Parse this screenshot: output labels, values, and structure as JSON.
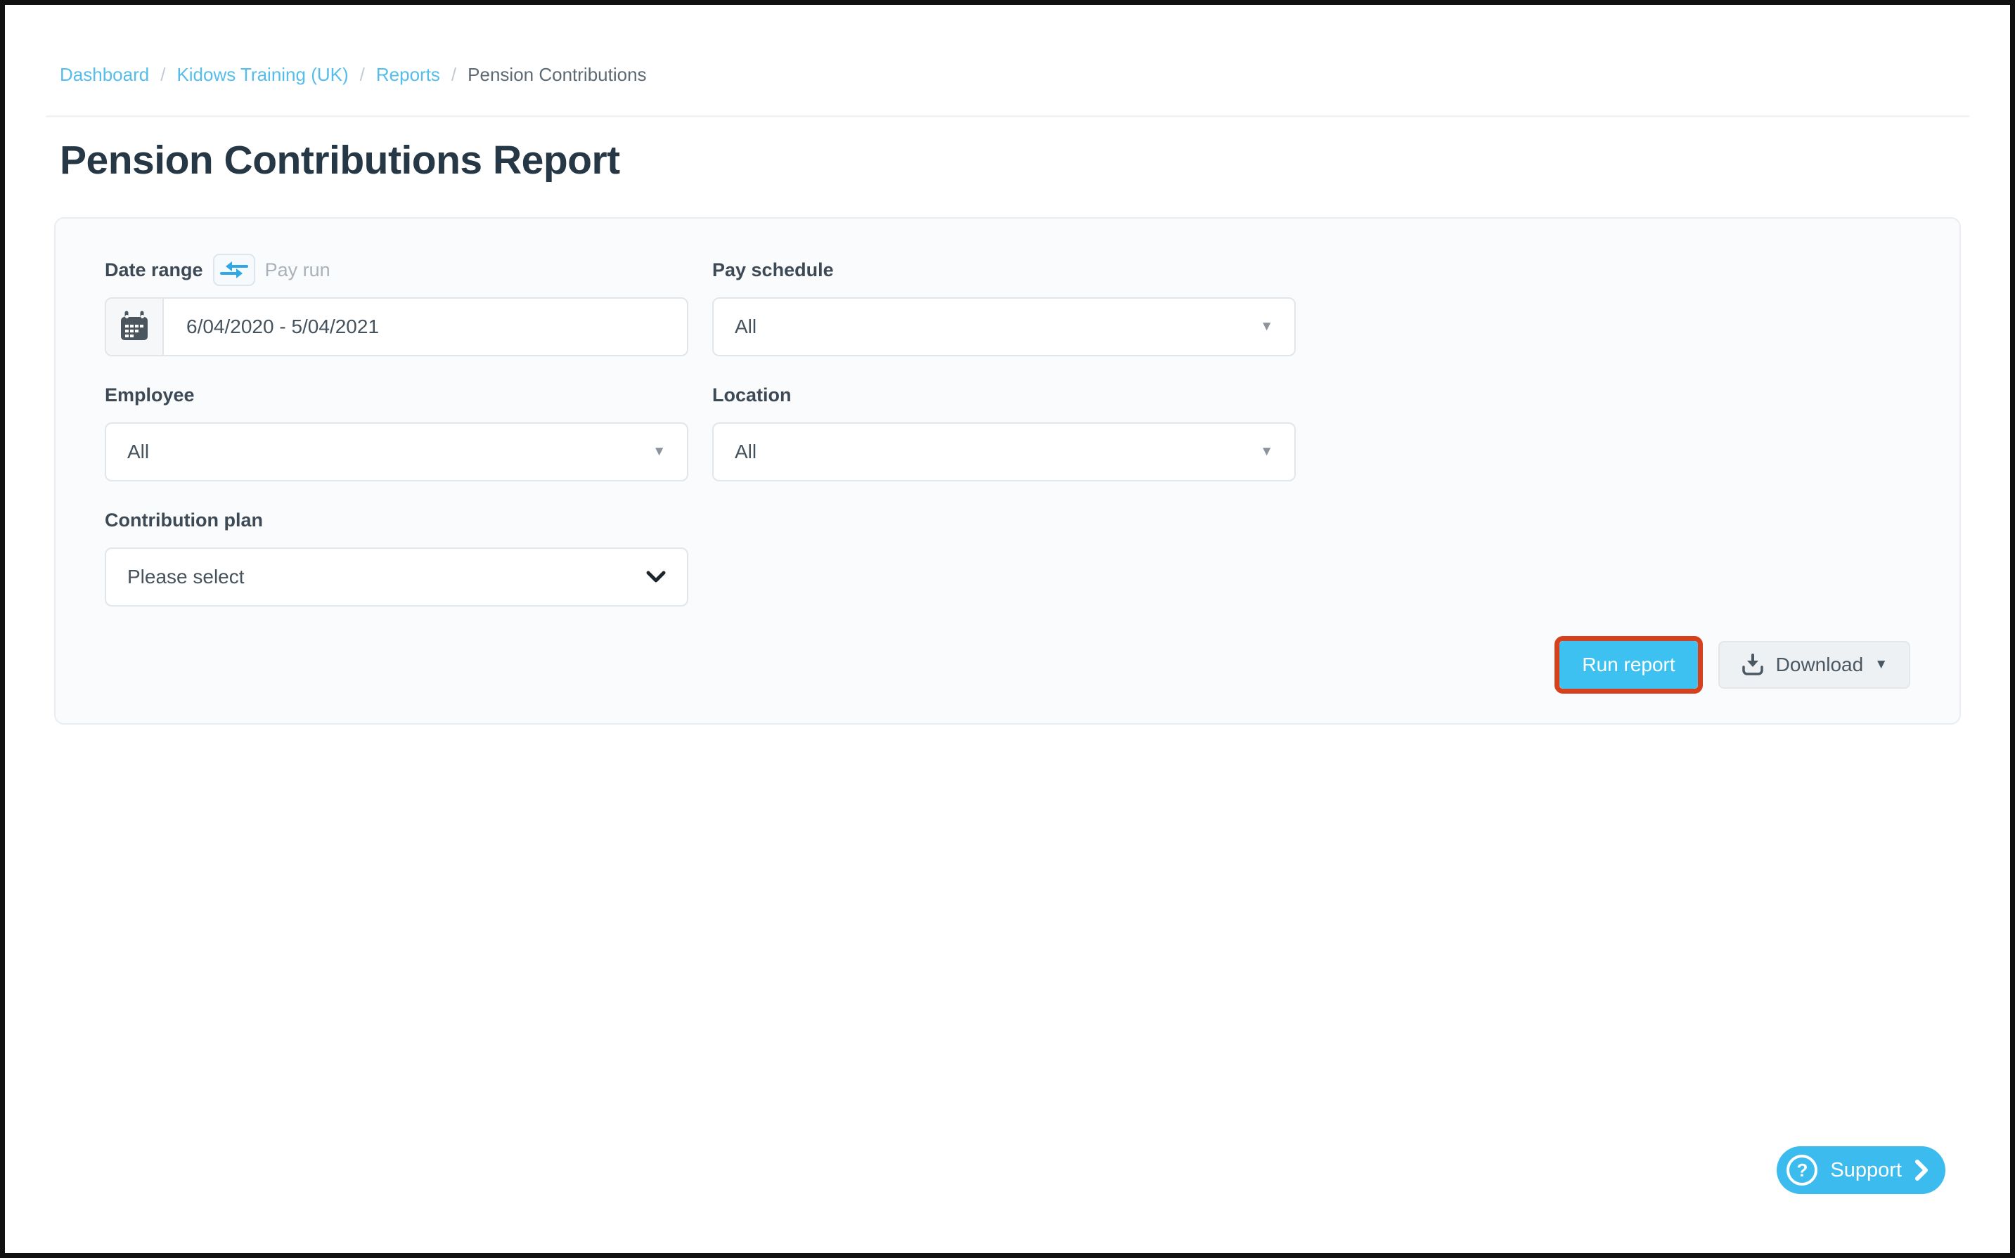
{
  "breadcrumb": {
    "separator": "/",
    "items": [
      {
        "label": "Dashboard"
      },
      {
        "label": "Kidows Training (UK)"
      },
      {
        "label": "Reports"
      }
    ],
    "current": "Pension Contributions"
  },
  "page": {
    "title": "Pension Contributions Report"
  },
  "filters": {
    "date_range": {
      "label": "Date range",
      "toggle_alt_label": "Pay run",
      "value": "6/04/2020 - 5/04/2021"
    },
    "pay_schedule": {
      "label": "Pay schedule",
      "value": "All"
    },
    "employee": {
      "label": "Employee",
      "value": "All"
    },
    "location": {
      "label": "Location",
      "value": "All"
    },
    "contribution_plan": {
      "label": "Contribution plan",
      "value": "Please select"
    }
  },
  "actions": {
    "run_report_label": "Run report",
    "download_label": "Download"
  },
  "support": {
    "label": "Support"
  },
  "icons": {
    "swap": "swap-arrows-icon",
    "calendar": "calendar-icon",
    "download": "download-icon",
    "caret": "caret-down-icon",
    "help": "question-mark-icon",
    "chevron": "chevron-right-icon"
  },
  "colors": {
    "accent_cyan": "#3dc1f0",
    "link_blue": "#55bdea",
    "annotation_red": "#d5411d",
    "title_dark": "#263845",
    "label_gray": "#3d4a55",
    "muted_gray": "#a9b2b9",
    "panel_bg": "#fafbfd",
    "panel_border": "#e9edf1"
  }
}
